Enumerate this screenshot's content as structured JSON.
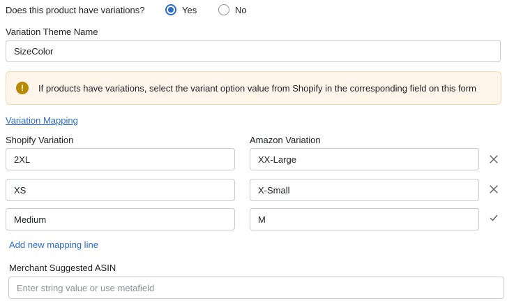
{
  "variations_question": {
    "label": "Does this product have variations?",
    "options": [
      {
        "label": "Yes",
        "checked": true
      },
      {
        "label": "No",
        "checked": false
      }
    ]
  },
  "theme": {
    "label": "Variation Theme Name",
    "value": "SizeColor"
  },
  "banner": {
    "icon": "warning-icon",
    "icon_glyph": "!",
    "text": "If products have variations, select the variant option value from Shopify in the corresponding field on this form",
    "background": "#fff5ea",
    "icon_color": "#b98900"
  },
  "mapping": {
    "link_label": "Variation Mapping",
    "shopify_header": "Shopify Variation",
    "amazon_header": "Amazon Variation",
    "rows": [
      {
        "shopify": "2XL",
        "amazon": "XX-Large",
        "action_icon": "close-icon"
      },
      {
        "shopify": "XS",
        "amazon": "X-Small",
        "action_icon": "close-icon"
      },
      {
        "shopify": "Medium",
        "amazon": "M",
        "action_icon": "checkmark-icon"
      }
    ],
    "add_line_label": "Add new mapping line"
  },
  "asin": {
    "label": "Merchant Suggested ASIN",
    "placeholder": "Enter string value or use metafield"
  },
  "colors": {
    "accent": "#2c6ecb",
    "border": "#c9cccf"
  }
}
